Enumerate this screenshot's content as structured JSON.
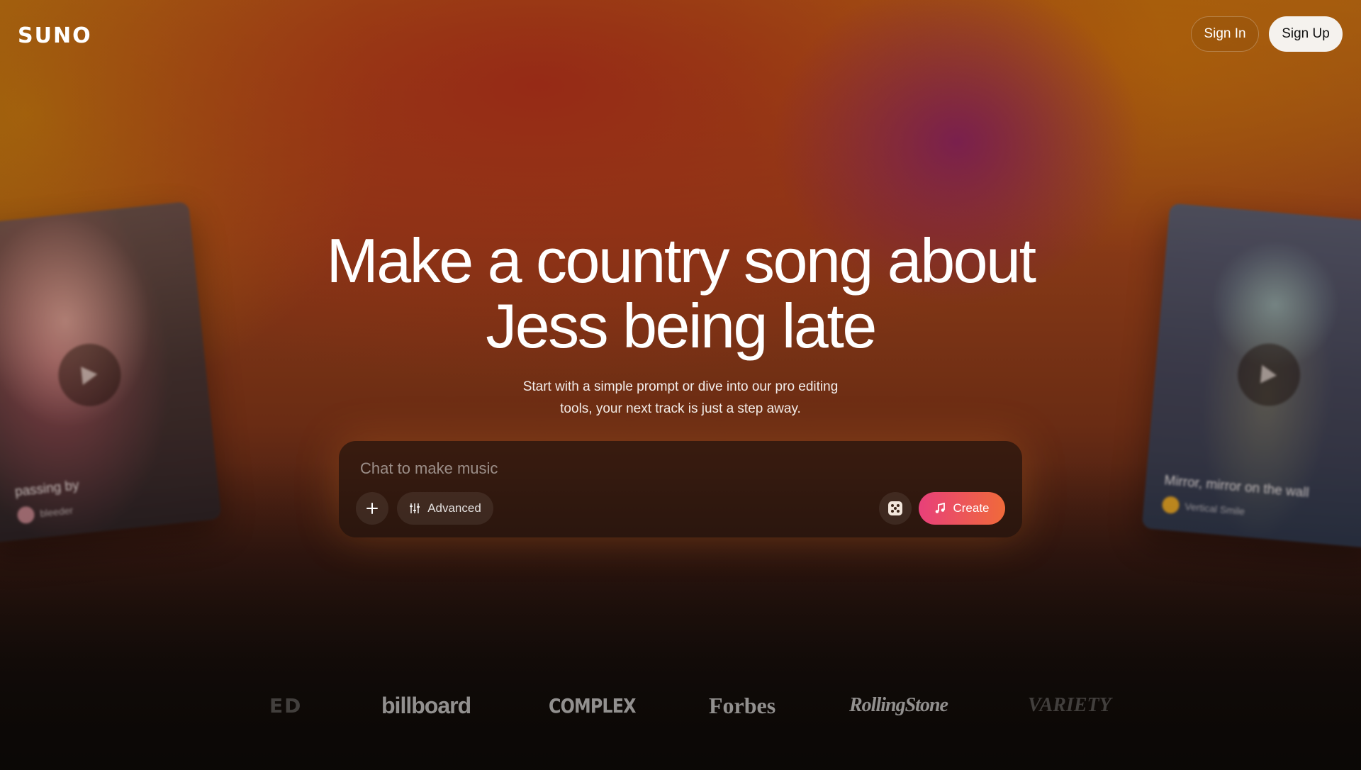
{
  "header": {
    "logo": "SUNO",
    "sign_in": "Sign In",
    "sign_up": "Sign Up"
  },
  "hero": {
    "title_line1": "Make a country song about",
    "title_line2": "Jess being late",
    "subtitle_line1": "Start with a simple prompt or dive into our pro editing",
    "subtitle_line2": "tools, your next track is just a step away."
  },
  "prompt": {
    "placeholder": "Chat to make music",
    "advanced_label": "Advanced",
    "create_label": "Create",
    "icons": {
      "add": "plus-icon",
      "advanced": "sliders-icon",
      "random": "dice-icon",
      "create": "music-note-icon"
    }
  },
  "cards": [
    {
      "title": "passing by",
      "artist": "bleeder"
    },
    {
      "title": "Mirror, mirror on the wall",
      "artist": "Vertical Smile"
    }
  ],
  "press": [
    "ED",
    "billboard",
    "COMPLEX",
    "Forbes",
    "RollingStone",
    "VARIETY"
  ],
  "colors": {
    "create_gradient_start": "#e8407a",
    "create_gradient_end": "#f06a3a",
    "sign_up_bg": "#f5f2ee"
  }
}
